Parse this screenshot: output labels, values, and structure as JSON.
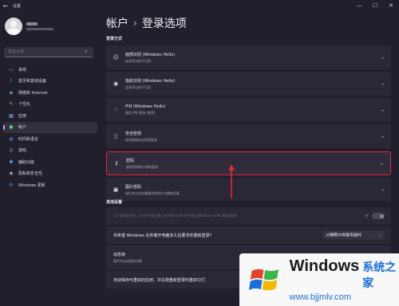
{
  "titlebar": {
    "app_title": "设置",
    "back": "←",
    "minimize": "—",
    "maximize": "☐",
    "close": "✕"
  },
  "sidebar": {
    "search_placeholder": "查找设置",
    "items": [
      {
        "label": "系统",
        "icon": "monitor-icon",
        "color": "#4aa3ff",
        "glyph": "▭"
      },
      {
        "label": "蓝牙和其他设备",
        "icon": "bluetooth-icon",
        "color": "#4aa3ff",
        "glyph": "ᛒ"
      },
      {
        "label": "网络和 Internet",
        "icon": "wifi-icon",
        "color": "#6bc1ff",
        "glyph": "◈"
      },
      {
        "label": "个性化",
        "icon": "brush-icon",
        "color": "#e0b069",
        "glyph": "✎"
      },
      {
        "label": "应用",
        "icon": "apps-icon",
        "color": "#8aa0c8",
        "glyph": "▦"
      },
      {
        "label": "帐户",
        "icon": "person-icon",
        "color": "#5fcf8a",
        "glyph": "●"
      },
      {
        "label": "时间和语言",
        "icon": "globe-icon",
        "color": "#4aa3ff",
        "glyph": "◍"
      },
      {
        "label": "游戏",
        "icon": "gamepad-icon",
        "color": "#9ea7b8",
        "glyph": "◎"
      },
      {
        "label": "辅助功能",
        "icon": "accessibility-icon",
        "color": "#5fb8ff",
        "glyph": "✱"
      },
      {
        "label": "隐私和安全性",
        "icon": "shield-icon",
        "color": "#9ea7b8",
        "glyph": "◆"
      },
      {
        "label": "Windows 更新",
        "icon": "update-icon",
        "color": "#4aa3ff",
        "glyph": "⟳"
      }
    ],
    "active_index": 5
  },
  "main": {
    "breadcrumb_parent": "帐户",
    "breadcrumb_sep": "›",
    "breadcrumb_current": "登录选项",
    "section_signin": "登录方式",
    "signin_options": [
      {
        "title": "面部识别 (Windows Hello)",
        "subtitle": "此选项当前不可用",
        "icon": "face-icon",
        "glyph": "☺"
      },
      {
        "title": "指纹识别 (Windows Hello)",
        "subtitle": "此选项当前不可用",
        "icon": "fingerprint-icon",
        "glyph": "◉"
      },
      {
        "title": "PIN (Windows Hello)",
        "subtitle": "使用 PIN 登录 (推荐)",
        "icon": "pin-icon",
        "glyph": "⁙"
      },
      {
        "title": "安全密钥",
        "subtitle": "使用物理安全密钥登录",
        "icon": "usb-key-icon",
        "glyph": "▯"
      },
      {
        "title": "密码",
        "subtitle": "使用你的帐户密码登录",
        "icon": "key-icon",
        "glyph": "⚷"
      },
      {
        "title": "图片密码",
        "subtitle": "轻扫并点击你最喜欢的照片以解锁设备",
        "icon": "picture-icon",
        "glyph": "▣"
      }
    ],
    "chevron": "⌄",
    "section_other": "其他设置",
    "other_settings": {
      "hello_only": {
        "text": "为了提高安全性，仅允许对此设备上的 Microsoft 帐户使用 Windows Hello 登录(推荐)",
        "toggle_label": "开"
      },
      "reauth": {
        "title": "你希望 Windows 在你离开电脑多久后要求你重新登录?",
        "value": "从睡眠中唤醒电脑时"
      },
      "dynamic_lock": {
        "title": "动态锁",
        "subtitle": "离开时自动锁定设备"
      },
      "restart_apps": {
        "title": "自动保存可重启的应用，并在我重新登录时重启它们"
      }
    }
  },
  "watermark": {
    "brand": "Windows",
    "brand_cn": "系统之家",
    "url": "www.bjjmlv.com",
    "colors": [
      "#e8412b",
      "#3cb549",
      "#1a6fd8",
      "#f5b700"
    ]
  }
}
